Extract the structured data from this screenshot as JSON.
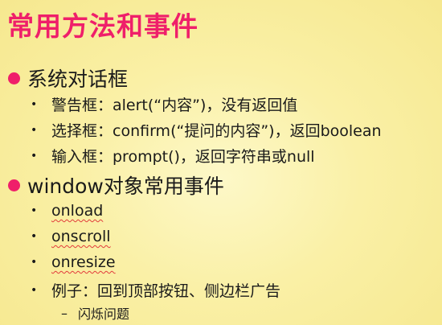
{
  "slide": {
    "title": "常用方法和事件",
    "accent_color": "#ef1f6a",
    "sections": [
      {
        "heading": "系统对话框",
        "items": [
          "警告框：alert(“内容”)，没有返回值",
          "选择框：confirm(“提问的内容”)，返回boolean",
          "输入框：prompt()，返回字符串或null"
        ]
      },
      {
        "heading": "window对象常用事件",
        "items": [
          "onload",
          "onscroll",
          "onresize",
          "例子：回到顶部按钮、侧边栏广告"
        ],
        "subitems": [
          "闪烁问题"
        ]
      }
    ]
  }
}
